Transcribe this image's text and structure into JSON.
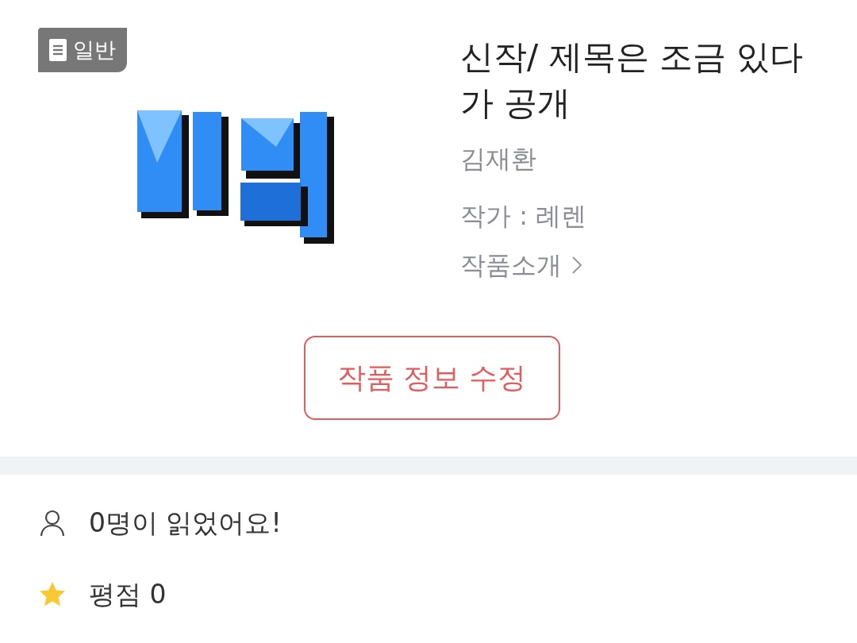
{
  "work": {
    "badge": "일반",
    "title": "신작/ 제목은 조금 있다가 공개",
    "author": "김재환",
    "writer": "작가 : 례렌",
    "intro_link": "작품소개",
    "edit_button": "작품 정보 수정"
  },
  "stats": [
    {
      "kind": "readers",
      "text": "0명이 읽었어요!"
    },
    {
      "kind": "rating",
      "text": "평점 0"
    }
  ]
}
